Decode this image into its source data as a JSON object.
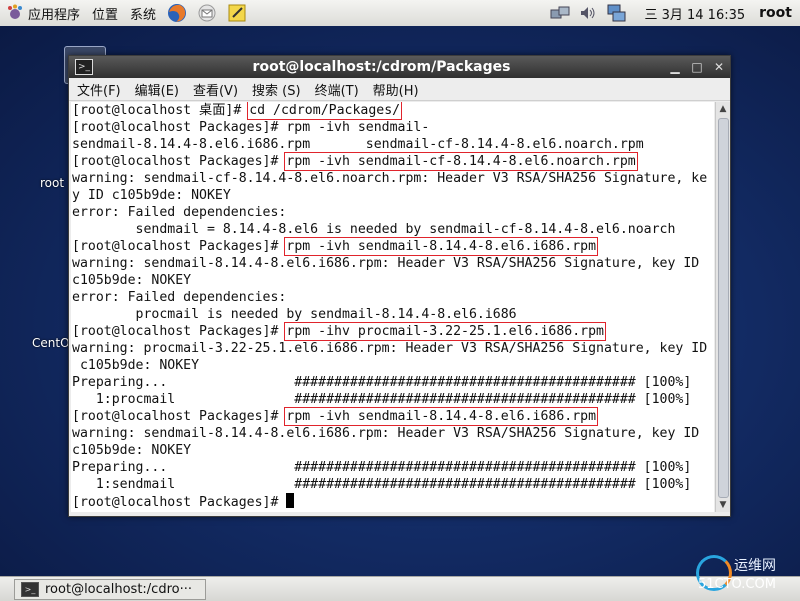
{
  "top_panel": {
    "menus": [
      "应用程序",
      "位置",
      "系统"
    ],
    "clock": "三 3月 14 16:35",
    "user": "root"
  },
  "desktop": {
    "icons": [
      "root",
      "CentO"
    ]
  },
  "window": {
    "title": "root@localhost:/cdrom/Packages",
    "menu": [
      "文件(F)",
      "编辑(E)",
      "查看(V)",
      "搜索 (S)",
      "终端(T)",
      "帮助(H)"
    ]
  },
  "terminal": {
    "lines": [
      {
        "pre": "[root@localhost 桌面]# ",
        "hl": "cd /cdrom/Packages/",
        "post": ""
      },
      {
        "pre": "[root@localhost Packages]# rpm -ivh sendmail-",
        "hl": "",
        "post": ""
      },
      {
        "pre": "sendmail-8.14.4-8.el6.i686.rpm       sendmail-cf-8.14.4-8.el6.noarch.rpm",
        "hl": "",
        "post": ""
      },
      {
        "pre": "[root@localhost Packages]# ",
        "hl": "rpm -ivh sendmail-cf-8.14.4-8.el6.noarch.rpm",
        "post": ""
      },
      {
        "pre": "warning: sendmail-cf-8.14.4-8.el6.noarch.rpm: Header V3 RSA/SHA256 Signature, ke",
        "hl": "",
        "post": ""
      },
      {
        "pre": "y ID c105b9de: NOKEY",
        "hl": "",
        "post": ""
      },
      {
        "pre": "error: Failed dependencies:",
        "hl": "",
        "post": ""
      },
      {
        "pre": "        sendmail = 8.14.4-8.el6 is needed by sendmail-cf-8.14.4-8.el6.noarch",
        "hl": "",
        "post": ""
      },
      {
        "pre": "[root@localhost Packages]# ",
        "hl": "rpm -ivh sendmail-8.14.4-8.el6.i686.rpm",
        "post": ""
      },
      {
        "pre": "warning: sendmail-8.14.4-8.el6.i686.rpm: Header V3 RSA/SHA256 Signature, key ID",
        "hl": "",
        "post": ""
      },
      {
        "pre": "c105b9de: NOKEY",
        "hl": "",
        "post": ""
      },
      {
        "pre": "error: Failed dependencies:",
        "hl": "",
        "post": ""
      },
      {
        "pre": "        procmail is needed by sendmail-8.14.4-8.el6.i686",
        "hl": "",
        "post": ""
      },
      {
        "pre": "[root@localhost Packages]# ",
        "hl": "rpm -ihv procmail-3.22-25.1.el6.i686.rpm",
        "post": ""
      },
      {
        "pre": "warning: procmail-3.22-25.1.el6.i686.rpm: Header V3 RSA/SHA256 Signature, key ID",
        "hl": "",
        "post": ""
      },
      {
        "pre": " c105b9de: NOKEY",
        "hl": "",
        "post": ""
      },
      {
        "pre": "Preparing...                ########################################### [100%]",
        "hl": "",
        "post": ""
      },
      {
        "pre": "   1:procmail               ########################################### [100%]",
        "hl": "",
        "post": ""
      },
      {
        "pre": "[root@localhost Packages]# ",
        "hl": "rpm -ivh sendmail-8.14.4-8.el6.i686.rpm",
        "post": ""
      },
      {
        "pre": "warning: sendmail-8.14.4-8.el6.i686.rpm: Header V3 RSA/SHA256 Signature, key ID",
        "hl": "",
        "post": ""
      },
      {
        "pre": "c105b9de: NOKEY",
        "hl": "",
        "post": ""
      },
      {
        "pre": "Preparing...                ########################################### [100%]",
        "hl": "",
        "post": ""
      },
      {
        "pre": "   1:sendmail               ########################################### [100%]",
        "hl": "",
        "post": ""
      }
    ],
    "prompt": "[root@localhost Packages]# "
  },
  "taskbar": {
    "item": "root@localhost:/cdro···"
  },
  "watermark": {
    "line1": "运维网",
    "line2": "51CTO.COM"
  }
}
